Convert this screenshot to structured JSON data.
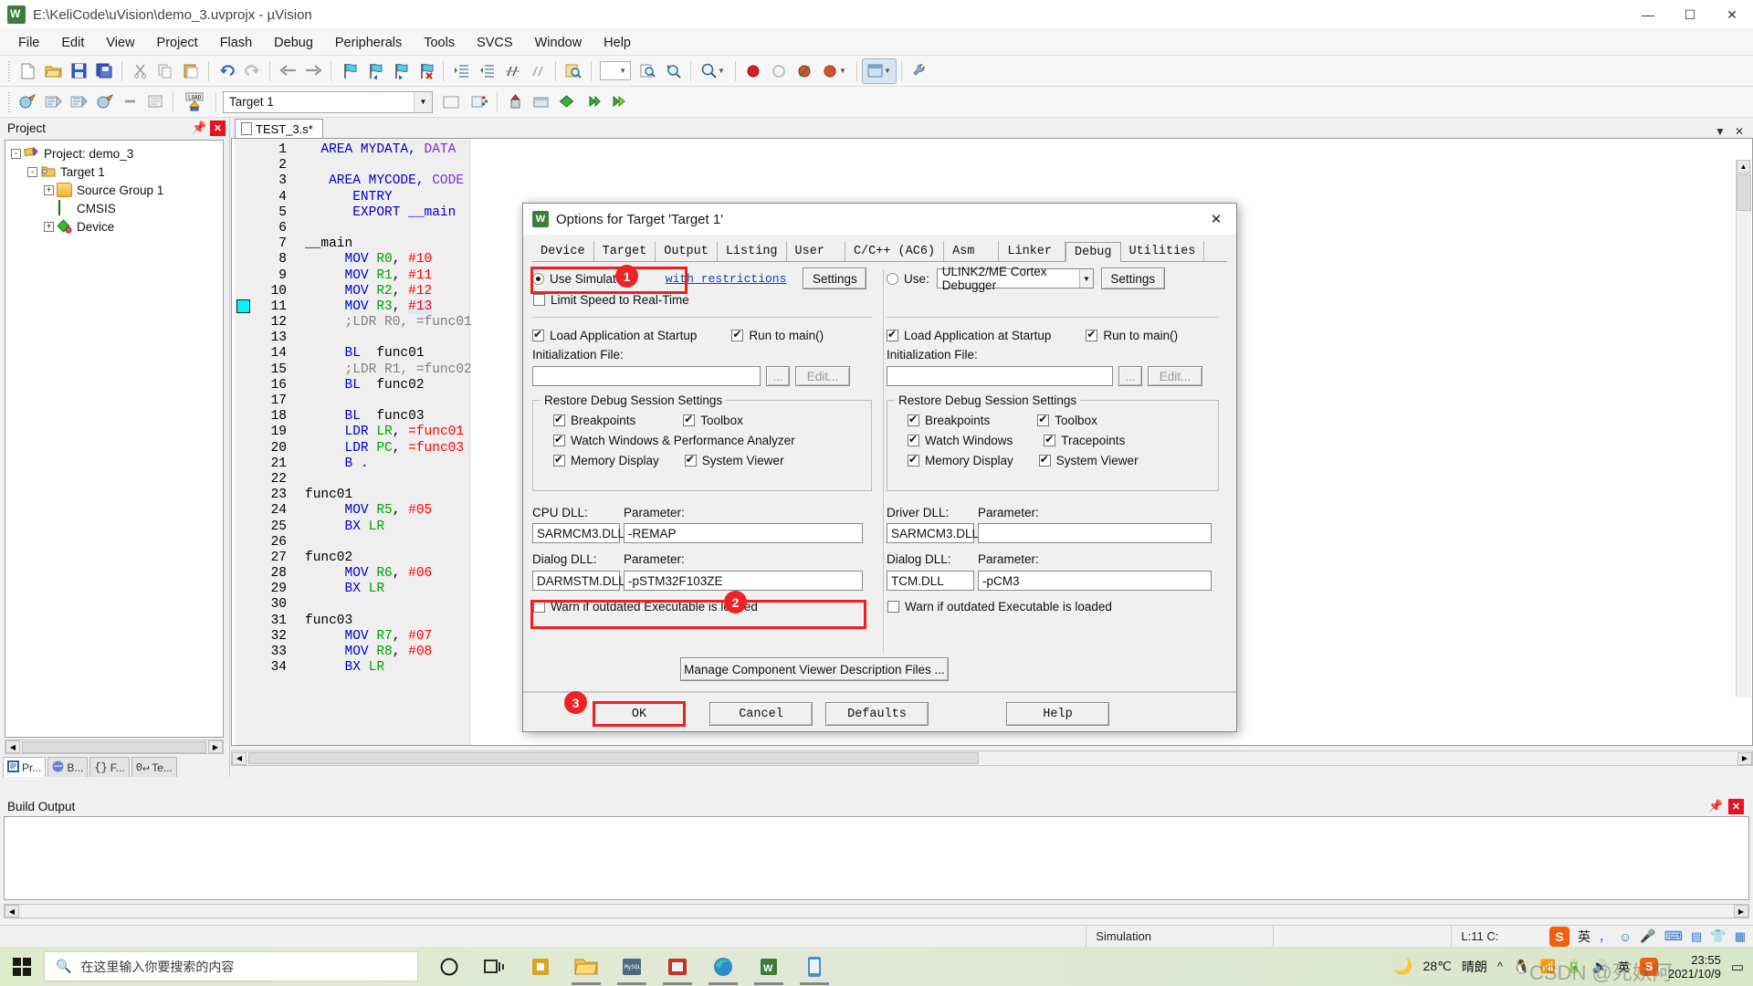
{
  "window": {
    "title": "E:\\KeliCode\\uVision\\demo_3.uvprojx - µVision",
    "minimize": "—",
    "maximize": "☐",
    "close": "✕"
  },
  "menu": [
    "File",
    "Edit",
    "View",
    "Project",
    "Flash",
    "Debug",
    "Peripherals",
    "Tools",
    "SVCS",
    "Window",
    "Help"
  ],
  "toolbar2": {
    "target_value": "Target 1"
  },
  "project_panel": {
    "title": "Project",
    "tree": [
      {
        "label": "Project: demo_3",
        "depth": 0,
        "expander": "-",
        "icon": "project-icon"
      },
      {
        "label": "Target 1",
        "depth": 1,
        "expander": "-",
        "icon": "target-folder-icon"
      },
      {
        "label": "Source Group 1",
        "depth": 2,
        "expander": "+",
        "icon": "folder-icon"
      },
      {
        "label": "CMSIS",
        "depth": 2,
        "expander": "",
        "icon": "component-icon"
      },
      {
        "label": "Device",
        "depth": 2,
        "expander": "+",
        "icon": "device-icon"
      }
    ],
    "tabs": [
      {
        "label": "Pr...",
        "active": true
      },
      {
        "label": "B...",
        "active": false
      },
      {
        "label": "F...",
        "active": false
      },
      {
        "label": "Te...",
        "active": false
      }
    ]
  },
  "editor": {
    "tab": "TEST_3.s*",
    "breakpoint_line": 11,
    "lines": [
      {
        "n": 1,
        "segs": [
          {
            "t": "  AREA MYDATA, ",
            "c": "kw"
          },
          {
            "t": "DATA",
            "c": "kw2"
          }
        ]
      },
      {
        "n": 2,
        "segs": []
      },
      {
        "n": 3,
        "segs": [
          {
            "t": "   AREA MYCODE, ",
            "c": "kw"
          },
          {
            "t": "CODE",
            "c": "kw2"
          }
        ]
      },
      {
        "n": 4,
        "segs": [
          {
            "t": "      ENTRY",
            "c": "kw"
          }
        ]
      },
      {
        "n": 5,
        "segs": [
          {
            "t": "      EXPORT __main",
            "c": "kw"
          }
        ]
      },
      {
        "n": 6,
        "segs": []
      },
      {
        "n": 7,
        "segs": [
          {
            "t": "__main",
            "c": ""
          }
        ]
      },
      {
        "n": 8,
        "segs": [
          {
            "t": "     MOV ",
            "c": "kw"
          },
          {
            "t": "R0",
            "c": "reg"
          },
          {
            "t": ", ",
            "c": ""
          },
          {
            "t": "#10",
            "c": "num"
          }
        ]
      },
      {
        "n": 9,
        "segs": [
          {
            "t": "     MOV ",
            "c": "kw"
          },
          {
            "t": "R1",
            "c": "reg"
          },
          {
            "t": ", ",
            "c": ""
          },
          {
            "t": "#11",
            "c": "num"
          }
        ]
      },
      {
        "n": 10,
        "segs": [
          {
            "t": "     MOV ",
            "c": "kw"
          },
          {
            "t": "R2",
            "c": "reg"
          },
          {
            "t": ", ",
            "c": ""
          },
          {
            "t": "#12",
            "c": "num"
          }
        ]
      },
      {
        "n": 11,
        "segs": [
          {
            "t": "     MOV ",
            "c": "kw"
          },
          {
            "t": "R3",
            "c": "reg"
          },
          {
            "t": ", ",
            "c": ""
          },
          {
            "t": "#13",
            "c": "num hl"
          }
        ]
      },
      {
        "n": 12,
        "segs": [
          {
            "t": "     ;LDR R0, =func01",
            "c": "cmt"
          }
        ]
      },
      {
        "n": 13,
        "segs": []
      },
      {
        "n": 14,
        "segs": [
          {
            "t": "     BL  ",
            "c": "kw"
          },
          {
            "t": "func01",
            "c": ""
          }
        ]
      },
      {
        "n": 15,
        "segs": [
          {
            "t": "     ;LDR R1, =func02",
            "c": "cmt"
          }
        ]
      },
      {
        "n": 16,
        "segs": [
          {
            "t": "     BL  ",
            "c": "kw"
          },
          {
            "t": "func02",
            "c": ""
          }
        ]
      },
      {
        "n": 17,
        "segs": []
      },
      {
        "n": 18,
        "segs": [
          {
            "t": "     BL  ",
            "c": "kw"
          },
          {
            "t": "func03",
            "c": ""
          }
        ]
      },
      {
        "n": 19,
        "segs": [
          {
            "t": "     LDR ",
            "c": "kw"
          },
          {
            "t": "LR",
            "c": "reg"
          },
          {
            "t": ", ",
            "c": ""
          },
          {
            "t": "=func01",
            "c": "num"
          }
        ]
      },
      {
        "n": 20,
        "segs": [
          {
            "t": "     LDR ",
            "c": "kw"
          },
          {
            "t": "PC",
            "c": "reg"
          },
          {
            "t": ", ",
            "c": ""
          },
          {
            "t": "=func03",
            "c": "num"
          }
        ]
      },
      {
        "n": 21,
        "segs": [
          {
            "t": "     B .",
            "c": "kw"
          }
        ]
      },
      {
        "n": 22,
        "segs": []
      },
      {
        "n": 23,
        "segs": [
          {
            "t": "func01",
            "c": ""
          }
        ]
      },
      {
        "n": 24,
        "segs": [
          {
            "t": "     MOV ",
            "c": "kw"
          },
          {
            "t": "R5",
            "c": "reg"
          },
          {
            "t": ", ",
            "c": ""
          },
          {
            "t": "#05",
            "c": "num"
          }
        ]
      },
      {
        "n": 25,
        "segs": [
          {
            "t": "     BX ",
            "c": "kw"
          },
          {
            "t": "LR",
            "c": "reg"
          }
        ]
      },
      {
        "n": 26,
        "segs": []
      },
      {
        "n": 27,
        "segs": [
          {
            "t": "func02",
            "c": ""
          }
        ]
      },
      {
        "n": 28,
        "segs": [
          {
            "t": "     MOV ",
            "c": "kw"
          },
          {
            "t": "R6",
            "c": "reg"
          },
          {
            "t": ", ",
            "c": ""
          },
          {
            "t": "#06",
            "c": "num"
          }
        ]
      },
      {
        "n": 29,
        "segs": [
          {
            "t": "     BX ",
            "c": "kw"
          },
          {
            "t": "LR",
            "c": "reg"
          }
        ]
      },
      {
        "n": 30,
        "segs": []
      },
      {
        "n": 31,
        "segs": [
          {
            "t": "func03",
            "c": ""
          }
        ]
      },
      {
        "n": 32,
        "segs": [
          {
            "t": "     MOV ",
            "c": "kw"
          },
          {
            "t": "R7",
            "c": "reg"
          },
          {
            "t": ", ",
            "c": ""
          },
          {
            "t": "#07",
            "c": "num"
          }
        ]
      },
      {
        "n": 33,
        "segs": [
          {
            "t": "     MOV ",
            "c": "kw"
          },
          {
            "t": "R8",
            "c": "reg"
          },
          {
            "t": ", ",
            "c": ""
          },
          {
            "t": "#08",
            "c": "num"
          }
        ]
      },
      {
        "n": 34,
        "segs": [
          {
            "t": "     BX ",
            "c": "kw"
          },
          {
            "t": "LR",
            "c": "reg"
          }
        ]
      }
    ]
  },
  "build_output": {
    "title": "Build Output",
    "content": ""
  },
  "statusbar": {
    "simulation": "Simulation",
    "position": "L:11 C:"
  },
  "dialog": {
    "title": "Options for Target 'Target 1'",
    "close": "✕",
    "tabs": [
      {
        "label": "Device",
        "active": false
      },
      {
        "label": "Target",
        "active": false
      },
      {
        "label": "Output",
        "active": false
      },
      {
        "label": "Listing",
        "active": false
      },
      {
        "label": "User",
        "active": false
      },
      {
        "label": "C/C++ (AC6)",
        "active": false
      },
      {
        "label": "Asm",
        "active": false
      },
      {
        "label": "Linker",
        "active": false
      },
      {
        "label": "Debug",
        "active": true
      },
      {
        "label": "Utilities",
        "active": false
      }
    ],
    "left": {
      "use_simulator": "Use Simulator",
      "with_restrictions": "with restrictions",
      "settings": "Settings",
      "limit_speed": "Limit Speed to Real-Time",
      "limit_speed_checked": false,
      "load_app": "Load Application at Startup",
      "load_app_checked": true,
      "run_to_main": "Run to main()",
      "run_to_main_checked": true,
      "init_file_label": "Initialization File:",
      "init_file_value": "",
      "browse": "...",
      "edit": "Edit...",
      "restore_group": "Restore Debug Session Settings",
      "breakpoints": "Breakpoints",
      "breakpoints_checked": true,
      "toolbox": "Toolbox",
      "toolbox_checked": true,
      "watch_windows": "Watch Windows & Performance Analyzer",
      "watch_windows_checked": true,
      "memory_display": "Memory Display",
      "memory_display_checked": true,
      "system_viewer": "System Viewer",
      "system_viewer_checked": true,
      "cpu_dll_label": "CPU DLL:",
      "param_label": "Parameter:",
      "cpu_dll_value": "SARMCM3.DLL",
      "cpu_param_value": "-REMAP",
      "dialog_dll_label": "Dialog DLL:",
      "dialog_dll_value": "DARMSTM.DLL",
      "dialog_param_value": "-pSTM32F103ZE",
      "warn_outdated": "Warn if outdated Executable is loaded",
      "warn_outdated_checked": false
    },
    "right": {
      "use_label": "Use:",
      "use_selected": "ULINK2/ME Cortex Debugger",
      "settings": "Settings",
      "load_app": "Load Application at Startup",
      "load_app_checked": true,
      "run_to_main": "Run to main()",
      "run_to_main_checked": true,
      "init_file_label": "Initialization File:",
      "init_file_value": "",
      "browse": "...",
      "edit": "Edit...",
      "restore_group": "Restore Debug Session Settings",
      "breakpoints": "Breakpoints",
      "breakpoints_checked": true,
      "toolbox": "Toolbox",
      "toolbox_checked": true,
      "watch_windows": "Watch Windows",
      "watch_windows_checked": true,
      "tracepoints": "Tracepoints",
      "tracepoints_checked": true,
      "memory_display": "Memory Display",
      "memory_display_checked": true,
      "system_viewer": "System Viewer",
      "system_viewer_checked": true,
      "driver_dll_label": "Driver DLL:",
      "param_label": "Parameter:",
      "driver_dll_value": "SARMCM3.DLL",
      "driver_param_value": "",
      "dialog_dll_label": "Dialog DLL:",
      "dialog_dll_value": "TCM.DLL",
      "dialog_param_value": "-pCM3",
      "warn_outdated": "Warn if outdated Executable is loaded",
      "warn_outdated_checked": false
    },
    "manage_button": "Manage Component Viewer Description Files ...",
    "ok": "OK",
    "cancel": "Cancel",
    "defaults": "Defaults",
    "help": "Help",
    "annotations": [
      {
        "number": "1"
      },
      {
        "number": "2"
      },
      {
        "number": "3"
      }
    ]
  },
  "taskbar": {
    "search_placeholder": "在这里输入你要搜索的内容",
    "weather_temp": "28℃",
    "weather_desc": "晴朗",
    "clock_time": "23:55",
    "clock_date": "2021/10/9",
    "ime": "英",
    "watermark": "CSDN @死妖阿"
  }
}
